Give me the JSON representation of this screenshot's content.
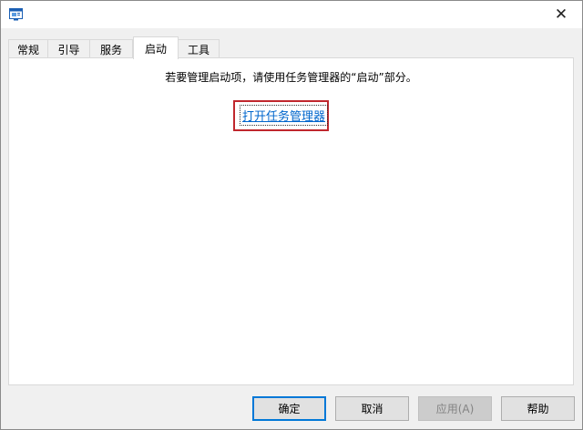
{
  "window": {
    "close_glyph": "✕"
  },
  "tabs": [
    {
      "label": "常规",
      "active": false
    },
    {
      "label": "引导",
      "active": false
    },
    {
      "label": "服务",
      "active": false
    },
    {
      "label": "启动",
      "active": true
    },
    {
      "label": "工具",
      "active": false
    }
  ],
  "startup": {
    "description": "若要管理启动项，请使用任务管理器的“启动”部分。",
    "link_label": "打开任务管理器",
    "highlight_color": "#c0272d"
  },
  "buttons": {
    "ok": "确定",
    "cancel": "取消",
    "apply": "应用(A)",
    "help": "帮助"
  },
  "icons": {
    "app": "msconfig-icon",
    "close": "close-icon"
  }
}
